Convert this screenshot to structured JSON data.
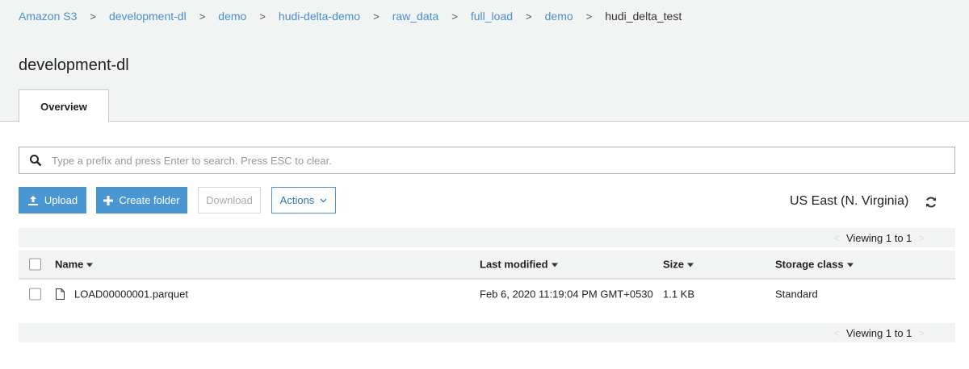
{
  "breadcrumb": {
    "items": [
      "Amazon S3",
      "development-dl",
      "demo",
      "hudi-delta-demo",
      "raw_data",
      "full_load",
      "demo"
    ],
    "current": "hudi_delta_test",
    "separator": ">"
  },
  "page_title": "development-dl",
  "tabs": [
    {
      "label": "Overview",
      "active": true
    }
  ],
  "search": {
    "placeholder": "Type a prefix and press Enter to search. Press ESC to clear.",
    "value": ""
  },
  "toolbar": {
    "upload": "Upload",
    "create_folder": "Create folder",
    "download": "Download",
    "actions": "Actions"
  },
  "region": "US East (N. Virginia)",
  "pagination": {
    "top": "Viewing 1 to 1",
    "bottom": "Viewing 1 to 1",
    "prev": "<",
    "next": ">"
  },
  "table": {
    "columns": [
      "Name",
      "Last modified",
      "Size",
      "Storage class"
    ],
    "rows": [
      {
        "name": "LOAD00000001.parquet",
        "last_modified": "Feb 6, 2020 11:19:04 PM GMT+0530",
        "size": "1.1 KB",
        "storage_class": "Standard"
      }
    ]
  },
  "colors": {
    "accent": "#4a96d2",
    "link": "#4a8fcf",
    "header_bg": "#f2f3f3"
  }
}
